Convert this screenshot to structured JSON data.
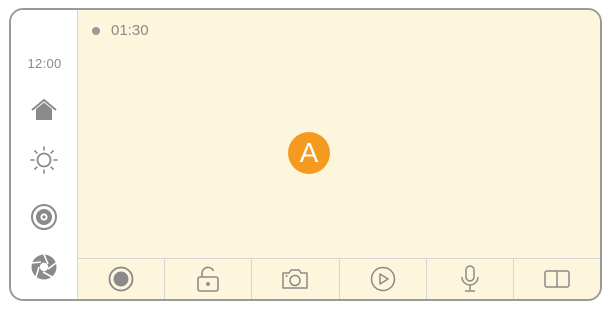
{
  "sidebar": {
    "clock": "12:00",
    "icons": [
      "home-icon",
      "sun-icon",
      "disc-icon",
      "aperture-icon"
    ]
  },
  "main": {
    "recording_time": "01:30",
    "badge_label": "A",
    "badge_color": "#f39a1f",
    "background_color": "#fdf6dc"
  },
  "toolbar": {
    "icons": [
      "record-icon",
      "unlock-icon",
      "camera-icon",
      "play-icon",
      "microphone-icon",
      "split-view-icon"
    ]
  }
}
